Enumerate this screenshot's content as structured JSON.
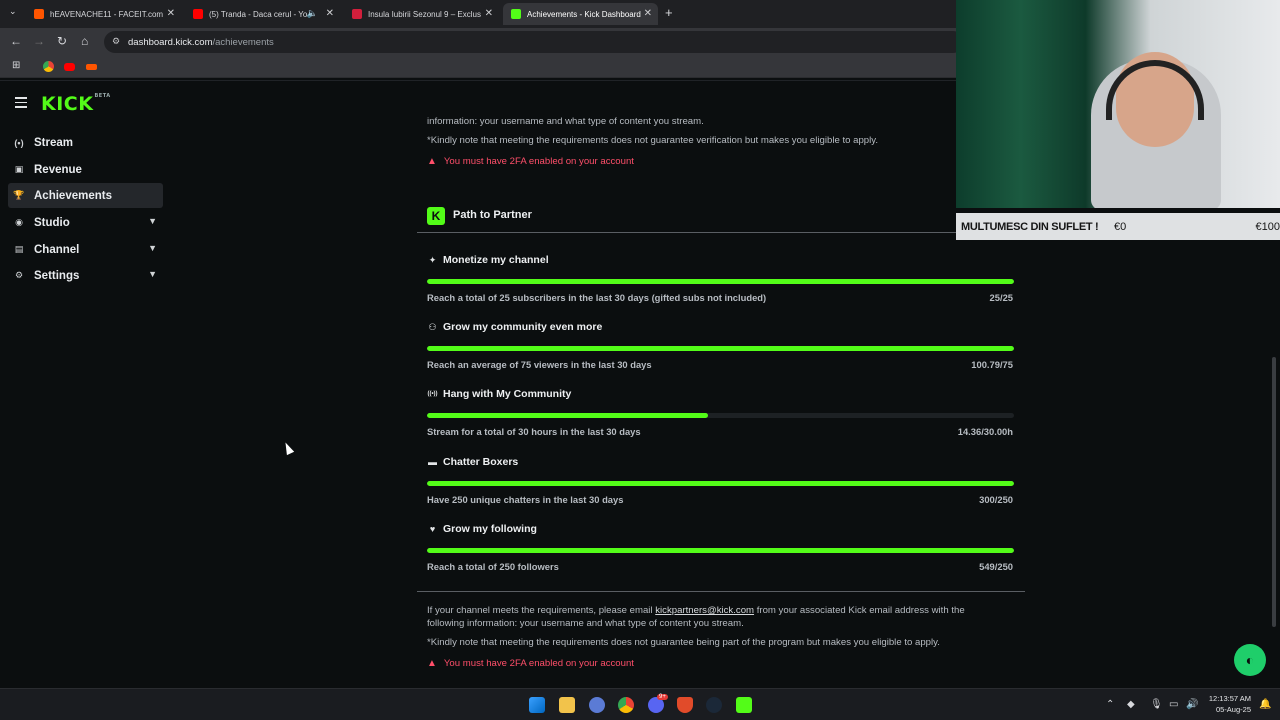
{
  "browser": {
    "tabs": [
      {
        "label": "hEAVENACHE11 - FACEIT.com",
        "favicon_color": "#ff5500"
      },
      {
        "label": "(5) Tranda - Daca cerul - Yo",
        "favicon_color": "#ff0000"
      },
      {
        "label": "Insula Iubirii Sezonul 9 – Exclus",
        "favicon_color": "#d21f3c"
      },
      {
        "label": "Achievements - Kick Dashboard",
        "favicon_color": "#53fc18"
      }
    ],
    "url_host": "dashboard.kick.com",
    "url_path": "/achievements"
  },
  "sidebar": {
    "logo": "KICK",
    "logo_badge": "BETA",
    "items": [
      {
        "label": "Stream",
        "icon": "stream-icon",
        "glyph": "(•)"
      },
      {
        "label": "Revenue",
        "icon": "revenue-icon",
        "glyph": "▣"
      },
      {
        "label": "Achievements",
        "icon": "trophy-icon",
        "glyph": "🏆",
        "active": true
      },
      {
        "label": "Studio",
        "icon": "studio-icon",
        "glyph": "◉",
        "expandable": true
      },
      {
        "label": "Channel",
        "icon": "channel-icon",
        "glyph": "▤",
        "expandable": true
      },
      {
        "label": "Settings",
        "icon": "gear-icon",
        "glyph": "⚙",
        "expandable": true
      }
    ]
  },
  "top_section": {
    "partial_line": "information: your username and what type of content you stream.",
    "note": "*Kindly note that meeting the requirements does not guarantee verification but makes you eligible to apply.",
    "warning": "You must have 2FA enabled on your account"
  },
  "partner": {
    "heading": "Path to Partner",
    "achievements": [
      {
        "title": "Monetize my channel",
        "icon": "sparkle-icon",
        "glyph": "✦",
        "requirement": "Reach a total of 25 subscribers in the last 30 days (gifted subs not included)",
        "progress_text": "25/25",
        "fraction": 1.0
      },
      {
        "title": "Grow my community even more",
        "icon": "users-icon",
        "glyph": "⚇",
        "requirement": "Reach an average of 75 viewers in the last 30 days",
        "progress_text": "100.79/75",
        "fraction": 1.0
      },
      {
        "title": "Hang with My Community",
        "icon": "broadcast-icon",
        "glyph": "((•))",
        "requirement": "Stream for a total of 30 hours in the last 30 days",
        "progress_text": "14.36/30.00h",
        "fraction": 0.4787
      },
      {
        "title": "Chatter Boxers",
        "icon": "chat-icon",
        "glyph": "▬",
        "requirement": "Have 250 unique chatters in the last 30 days",
        "progress_text": "300/250",
        "fraction": 1.0
      },
      {
        "title": "Grow my following",
        "icon": "heart-icon",
        "glyph": "♥",
        "requirement": "Reach a total of 250 followers",
        "progress_text": "549/250",
        "fraction": 1.0
      }
    ],
    "footer_line1_a": "If your channel meets the requirements, please email",
    "footer_email": "kickpartners@kick.com",
    "footer_line1_b": "from your associated Kick email address with the",
    "footer_line2": "following information: your username and what type of content you stream.",
    "footer_note": "*Kindly note that meeting the requirements does not guarantee being part of the program but makes you eligible to apply.",
    "footer_warning": "You must have 2FA enabled on your account"
  },
  "overlay": {
    "donation_text": "MULTUMESC DIN SUFLET !",
    "donation_current": "€0",
    "donation_goal": "€100"
  },
  "taskbar": {
    "time": "12:13:57 AM",
    "date": "05-Aug-25",
    "discord_badge": "9+"
  }
}
